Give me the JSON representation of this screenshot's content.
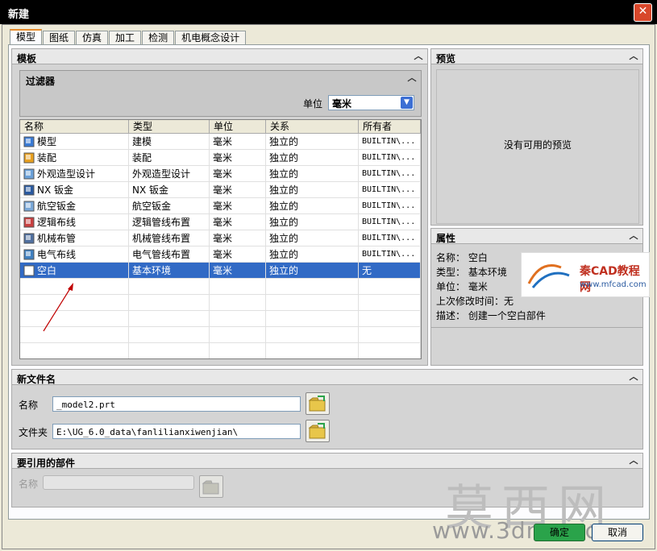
{
  "window": {
    "title": "新建",
    "close_glyph": "✕"
  },
  "tabs": [
    "模型",
    "图纸",
    "仿真",
    "加工",
    "检测",
    "机电概念设计"
  ],
  "templates": {
    "title": "模板",
    "filter": {
      "title": "过滤器",
      "unit_label": "单位",
      "unit_value": "毫米"
    },
    "columns": [
      "名称",
      "类型",
      "单位",
      "关系",
      "所有者"
    ],
    "rows": [
      {
        "name": "模型",
        "type": "建模",
        "unit": "毫米",
        "relation": "独立的",
        "owner": "BUILTIN\\...",
        "icon": "model-icon"
      },
      {
        "name": "装配",
        "type": "装配",
        "unit": "毫米",
        "relation": "独立的",
        "owner": "BUILTIN\\...",
        "icon": "assembly-icon"
      },
      {
        "name": "外观造型设计",
        "type": "外观造型设计",
        "unit": "毫米",
        "relation": "独立的",
        "owner": "BUILTIN\\...",
        "icon": "shape-design-icon"
      },
      {
        "name": "NX 钣金",
        "type": "NX 钣金",
        "unit": "毫米",
        "relation": "独立的",
        "owner": "BUILTIN\\...",
        "icon": "sheet-metal-icon"
      },
      {
        "name": "航空钣金",
        "type": "航空钣金",
        "unit": "毫米",
        "relation": "独立的",
        "owner": "BUILTIN\\...",
        "icon": "aero-sheet-metal-icon"
      },
      {
        "name": "逻辑布线",
        "type": "逻辑管线布置",
        "unit": "毫米",
        "relation": "独立的",
        "owner": "BUILTIN\\...",
        "icon": "logic-routing-icon"
      },
      {
        "name": "机械布管",
        "type": "机械管线布置",
        "unit": "毫米",
        "relation": "独立的",
        "owner": "BUILTIN\\...",
        "icon": "mechanical-routing-icon"
      },
      {
        "name": "电气布线",
        "type": "电气管线布置",
        "unit": "毫米",
        "relation": "独立的",
        "owner": "BUILTIN\\...",
        "icon": "electrical-routing-icon"
      },
      {
        "name": "空白",
        "type": "基本环境",
        "unit": "毫米",
        "relation": "独立的",
        "owner": "无",
        "icon": "blank-icon",
        "selected": true
      }
    ]
  },
  "preview": {
    "title": "预览",
    "empty_text": "没有可用的预览"
  },
  "properties": {
    "title": "属性",
    "name_label": "名称：",
    "name_value": "空白",
    "type_label": "类型：",
    "type_value": "基本环境",
    "unit_label": "单位：",
    "unit_value": "毫米",
    "modified_label": "上次修改时间：",
    "modified_value": "无",
    "desc_label": "描述：",
    "desc_value": "创建一个空白部件"
  },
  "new_file": {
    "title": "新文件名",
    "name_label": "名称",
    "name_value": "_model2.prt",
    "folder_label": "文件夹",
    "folder_value": "E:\\UG_6.0_data\\fanlilianxiwenjian\\"
  },
  "referenced": {
    "title": "要引用的部件",
    "name_label": "名称",
    "name_value": ""
  },
  "buttons": {
    "ok": "确定",
    "cancel": "取消"
  },
  "watermarks": {
    "logo_text": "秦CAD教程网",
    "logo_url": "www.mfcad.com",
    "big": "莫西网",
    "url": "www.3dmox.com"
  },
  "colors": {
    "selection": "#316ac5",
    "ok_button": "#2aa34a",
    "arrow": "#c00000"
  }
}
